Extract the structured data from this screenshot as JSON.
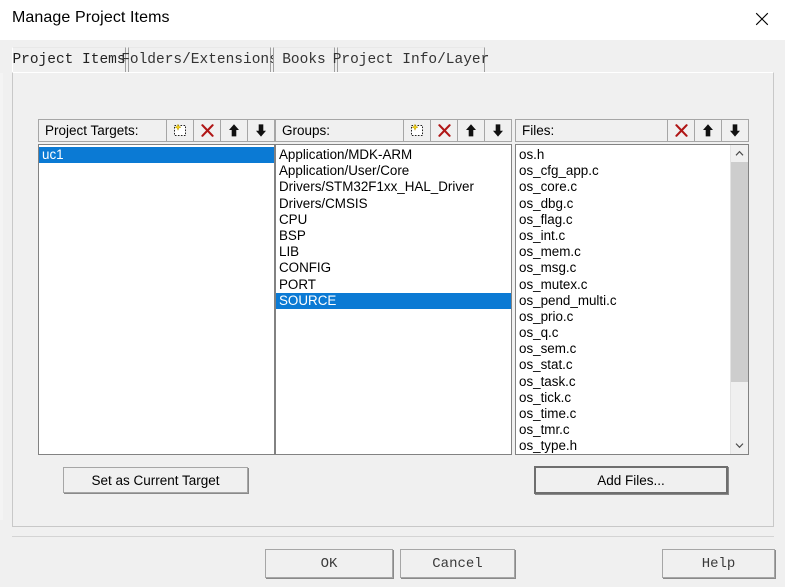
{
  "window": {
    "title": "Manage Project Items",
    "close_icon": "close-icon"
  },
  "tabs": [
    {
      "label": "Project Items",
      "selected": true
    },
    {
      "label": "Folders/Extensions",
      "selected": false
    },
    {
      "label": "Books",
      "selected": false
    },
    {
      "label": "Project Info/Layer",
      "selected": false
    }
  ],
  "colors": {
    "selection_blue": "#0b7ad4",
    "dialog_face": "#f0f0f0",
    "list_background": "#ffffff",
    "icon_delete_red": "#b01616",
    "icon_sparkle_yellow": "#f5d11a",
    "scrollbar_thumb": "#cdcdcd"
  },
  "panels": {
    "targets": {
      "header_label": "Project Targets:",
      "toolbar": [
        {
          "name": "new-item-icon",
          "title": "New (Insert)"
        },
        {
          "name": "delete-icon",
          "title": "Remove Item"
        },
        {
          "name": "arrow-up-icon",
          "title": "Move Up"
        },
        {
          "name": "arrow-down-icon",
          "title": "Move Down"
        }
      ],
      "items": [
        "uc1"
      ],
      "selected_index": 0
    },
    "groups": {
      "header_label": "Groups:",
      "toolbar": [
        {
          "name": "new-item-icon",
          "title": "New (Insert)"
        },
        {
          "name": "delete-icon",
          "title": "Remove Item"
        },
        {
          "name": "arrow-up-icon",
          "title": "Move Up"
        },
        {
          "name": "arrow-down-icon",
          "title": "Move Down"
        }
      ],
      "items": [
        "Application/MDK-ARM",
        "Application/User/Core",
        "Drivers/STM32F1xx_HAL_Driver",
        "Drivers/CMSIS",
        "CPU",
        "BSP",
        "LIB",
        "CONFIG",
        "PORT",
        "SOURCE"
      ],
      "selected_index": 9
    },
    "files": {
      "header_label": "Files:",
      "toolbar": [
        {
          "name": "delete-icon",
          "title": "Remove Item"
        },
        {
          "name": "arrow-up-icon",
          "title": "Move Up"
        },
        {
          "name": "arrow-down-icon",
          "title": "Move Down"
        }
      ],
      "items": [
        "os.h",
        "os_cfg_app.c",
        "os_core.c",
        "os_dbg.c",
        "os_flag.c",
        "os_int.c",
        "os_mem.c",
        "os_msg.c",
        "os_mutex.c",
        "os_pend_multi.c",
        "os_prio.c",
        "os_q.c",
        "os_sem.c",
        "os_stat.c",
        "os_task.c",
        "os_tick.c",
        "os_time.c",
        "os_tmr.c",
        "os_type.h"
      ],
      "selected_index": -1,
      "scrollbar": {
        "up_arrow_icon": "chevron-up-icon",
        "down_arrow_icon": "chevron-down-icon",
        "thumb_top_pct": 0,
        "thumb_height_pct": 80
      }
    }
  },
  "actions": {
    "set_current_target": "Set as Current Target",
    "add_files": "Add Files..."
  },
  "dialog_buttons": {
    "ok": "OK",
    "cancel": "Cancel",
    "help": "Help"
  }
}
